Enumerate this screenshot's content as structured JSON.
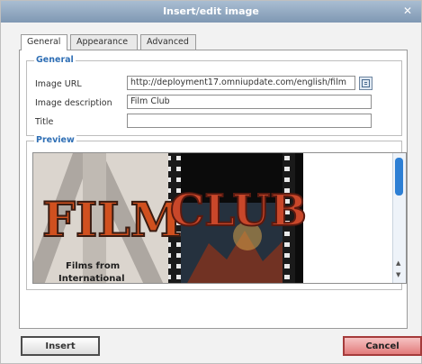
{
  "window": {
    "title": "Insert/edit image",
    "close_icon": "close-icon"
  },
  "tabs": [
    {
      "label": "General",
      "active": true
    },
    {
      "label": "Appearance",
      "active": false
    },
    {
      "label": "Advanced",
      "active": false
    }
  ],
  "general": {
    "legend": "General",
    "fields": {
      "url_label": "Image URL",
      "url_value": "http://deployment17.omniupdate.com/english/film",
      "desc_label": "Image description",
      "desc_value": "Film Club",
      "title_label": "Title",
      "title_value": ""
    }
  },
  "preview": {
    "legend": "Preview",
    "image_text": {
      "film": "FILM",
      "club": "CLUB",
      "subtitle_1": "Films from",
      "subtitle_2": "International"
    }
  },
  "buttons": {
    "insert": "Insert",
    "cancel": "Cancel"
  },
  "colors": {
    "accent": "#2f6fb5",
    "cancel": "#e27b7b",
    "title_bar": "#8ea6bf"
  }
}
